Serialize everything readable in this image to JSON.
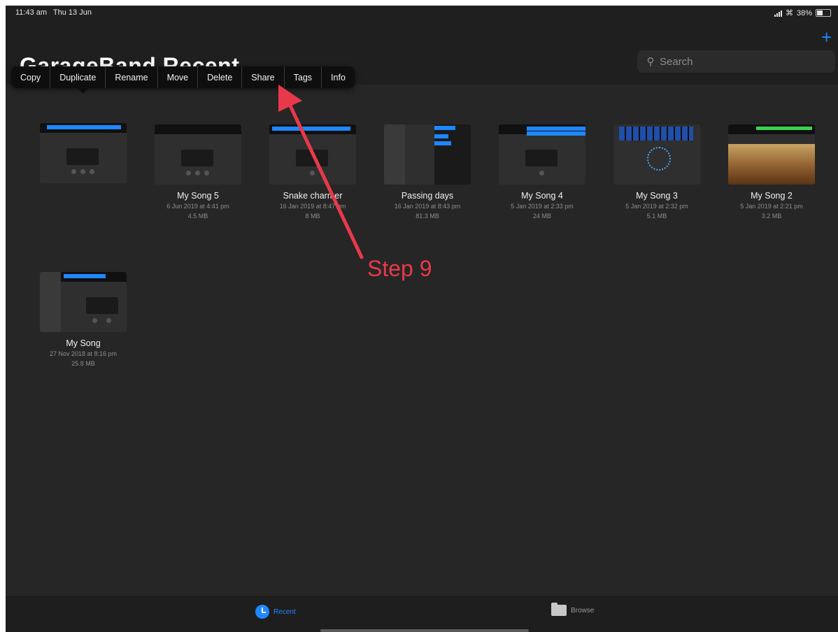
{
  "status_bar": {
    "time": "11:43 am",
    "date": "Thu 13 Jun",
    "battery": "38%"
  },
  "header": {
    "title": "GarageBand Recent",
    "search_placeholder": "Search"
  },
  "context_menu": {
    "items": [
      "Copy",
      "Duplicate",
      "Rename",
      "Move",
      "Delete",
      "Share",
      "Tags",
      "Info"
    ]
  },
  "songs": [
    {
      "name": "",
      "date": "",
      "size": ""
    },
    {
      "name": "My Song 5",
      "date": "6 Jun 2019 at 4:41 pm",
      "size": "4.5 MB"
    },
    {
      "name": "Snake charmer",
      "date": "16 Jan 2019 at 8:47 pm",
      "size": "8 MB"
    },
    {
      "name": "Passing days",
      "date": "16 Jan 2019 at 8:43 pm",
      "size": "81.3 MB"
    },
    {
      "name": "My Song 4",
      "date": "5 Jan 2019 at 2:33 pm",
      "size": "24 MB"
    },
    {
      "name": "My Song 3",
      "date": "5 Jan 2019 at 2:32 pm",
      "size": "5.1 MB"
    },
    {
      "name": "My Song 2",
      "date": "5 Jan 2019 at 2:21 pm",
      "size": "3.2 MB"
    },
    {
      "name": "My Song",
      "date": "27 Nov 2018 at 8:16 pm",
      "size": "25.8 MB"
    }
  ],
  "tab_bar": {
    "recent": "Recent",
    "browse": "Browse"
  },
  "annotation": {
    "label": "Step 9",
    "color": "#e8394a"
  },
  "colors": {
    "accent": "#1f87ff",
    "background": "#262626"
  }
}
